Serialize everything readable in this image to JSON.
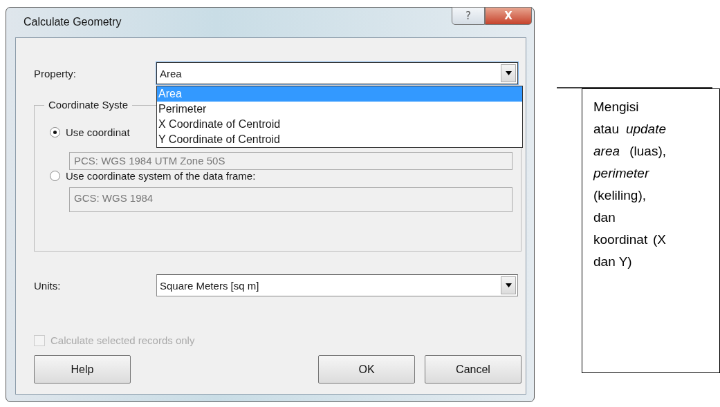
{
  "window": {
    "title": "Calculate Geometry",
    "title_buttons": [
      "?",
      "X"
    ]
  },
  "property": {
    "label": "Property:",
    "value": "Area",
    "expanded": true,
    "options": [
      {
        "label": "Area",
        "selected": true
      },
      {
        "label": "Perimeter",
        "selected": false
      },
      {
        "label": "X Coordinate of Centroid",
        "selected": false
      },
      {
        "label": "Y Coordinate of Centroid",
        "selected": false
      }
    ]
  },
  "coordinate_system": {
    "legend": "Coordinate Syste",
    "options": [
      {
        "label": "Use coordinat",
        "selected": true,
        "value": "PCS: WGS 1984 UTM Zone 50S"
      },
      {
        "label": "Use coordinate system of the data frame:",
        "selected": false,
        "value": "GCS: WGS 1984"
      }
    ]
  },
  "units": {
    "label": "Units:",
    "value": "Square Meters [sq m]"
  },
  "selected_only": {
    "label": "Calculate selected records only",
    "checked": false,
    "disabled": true
  },
  "buttons": [
    "Help",
    "OK",
    "Cancel"
  ],
  "callout": {
    "text": "Mengisi atau *update area* (luas), *perimeter* (keliling), dan koordinat (X dan Y)"
  }
}
